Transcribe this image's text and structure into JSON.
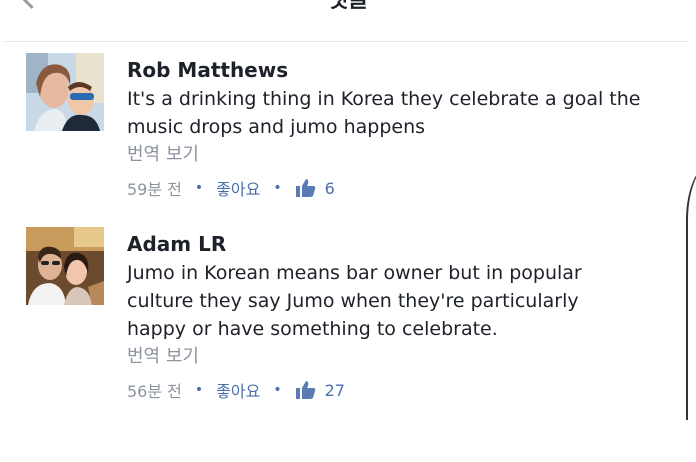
{
  "header": {
    "title": "댓글"
  },
  "comments": [
    {
      "author": "Rob Matthews",
      "text_lines": [
        "It's a drinking thing in Korea they celebrate a goal the",
        "music drops and jumo happens"
      ],
      "translate_label": "번역 보기",
      "time": "59분 전",
      "like_label": "좋아요",
      "like_count": "6"
    },
    {
      "author": "Adam LR",
      "text_lines": [
        "Jumo in Korean means bar owner but in popular",
        "culture they say Jumo when they're particularly",
        "happy or have something to celebrate."
      ],
      "translate_label": "번역 보기",
      "time": "56분 전",
      "like_label": "좋아요",
      "like_count": "27"
    }
  ],
  "colors": {
    "link": "#4b6fa8",
    "muted": "#8d949e",
    "text": "#1d2129"
  },
  "icons": [
    "back-chevron-icon",
    "thumbs-up-icon"
  ]
}
